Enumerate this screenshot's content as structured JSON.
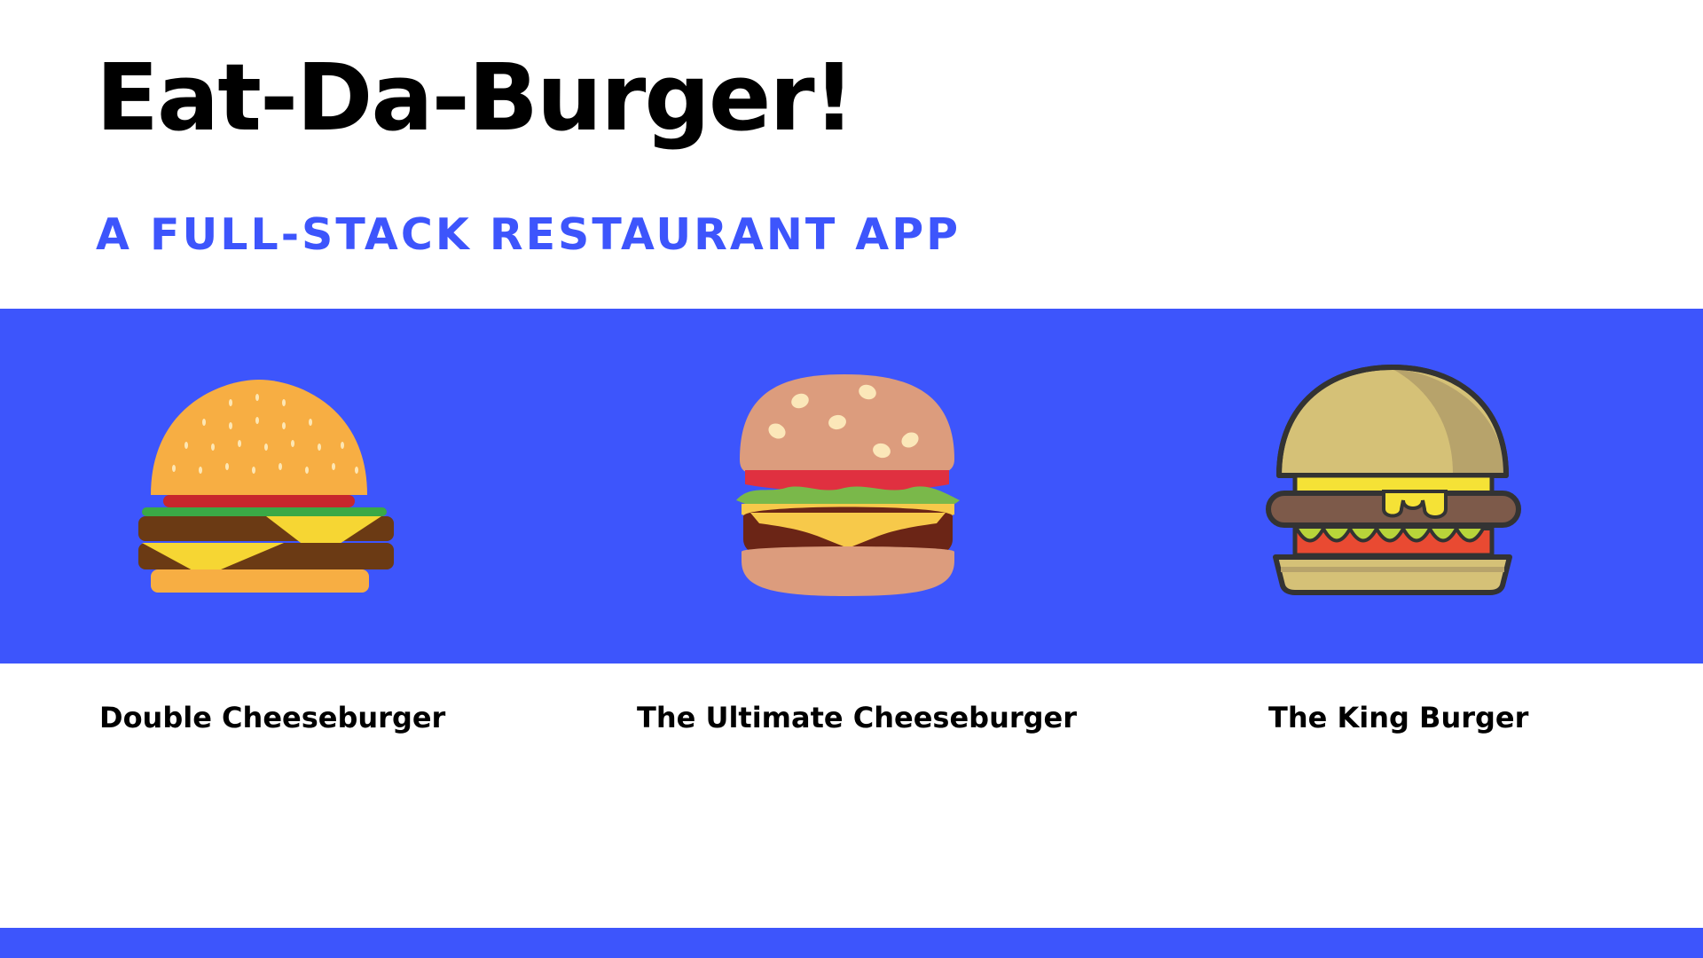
{
  "header": {
    "title": "Eat-Da-Burger!",
    "subtitle": "A FULL-STACK RESTAURANT APP"
  },
  "colors": {
    "accent": "#3d55fc",
    "background": "#ffffff",
    "text": "#000000"
  },
  "burgers": [
    {
      "name": "Double Cheeseburger",
      "icon": "double-cheeseburger-icon"
    },
    {
      "name": "The Ultimate Cheeseburger",
      "icon": "ultimate-cheeseburger-icon"
    },
    {
      "name": "The King Burger",
      "icon": "king-burger-icon"
    }
  ]
}
